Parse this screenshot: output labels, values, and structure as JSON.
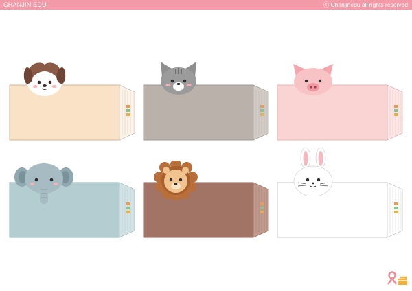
{
  "header": {
    "brand": "CHANJIN EDU",
    "copyright": "ⓒ Chanjinedu all rights reserved"
  },
  "colors": {
    "topbar": "#f29aa7",
    "envelope_dog": "#f9e2c6",
    "envelope_cat": "#bab1ab",
    "envelope_pig": "#f9d4d3",
    "envelope_elephant": "#b3cdd0",
    "envelope_lion": "#a17466",
    "envelope_rabbit": "#ffffff"
  },
  "cards": [
    {
      "animal": "dog",
      "icon": "dog-face-icon"
    },
    {
      "animal": "cat",
      "icon": "cat-face-icon"
    },
    {
      "animal": "pig",
      "icon": "pig-face-icon"
    },
    {
      "animal": "elephant",
      "icon": "elephant-face-icon"
    },
    {
      "animal": "lion",
      "icon": "lion-face-icon"
    },
    {
      "animal": "rabbit",
      "icon": "rabbit-face-icon"
    }
  ],
  "footer": {
    "logo": "chanjin-logo-icon"
  }
}
